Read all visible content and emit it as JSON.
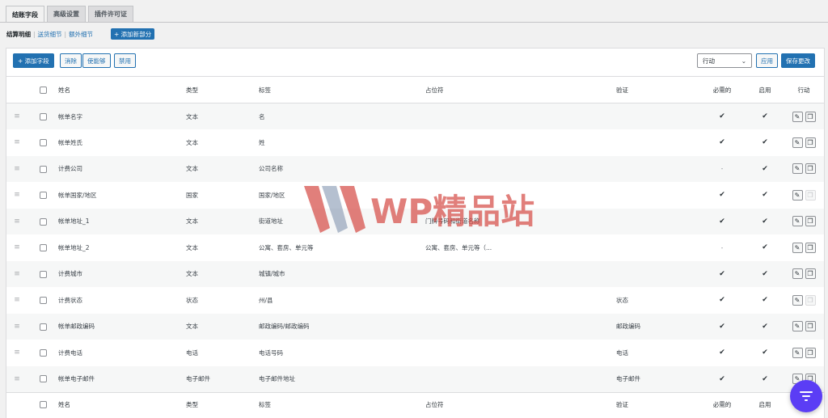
{
  "tabs": [
    {
      "label": "结账字段",
      "active": true
    },
    {
      "label": "高级设置",
      "active": false
    },
    {
      "label": "插件许可证",
      "active": false
    }
  ],
  "sections": {
    "current": "结算明细",
    "links": [
      "送货细节",
      "额外细节"
    ],
    "add_section_label": "+ 添加新部分"
  },
  "toolbar": {
    "add_field": "+ 添加字段",
    "remove": "消除",
    "enable": "使能够",
    "disable": "禁用",
    "action_select": "行动",
    "apply": "应用",
    "save": "保存更改"
  },
  "columns": {
    "name": "姓名",
    "type": "类型",
    "label": "标签",
    "placeholder": "占位符",
    "validation": "验证",
    "required": "必需的",
    "enabled": "启用",
    "actions": "行动"
  },
  "rows": [
    {
      "name": "帐单名字",
      "type": "文本",
      "label": "名",
      "placeholder": "",
      "validation": "",
      "required": "✔",
      "enabled": "✔",
      "dup_enabled": true
    },
    {
      "name": "帐单姓氏",
      "type": "文本",
      "label": "姓",
      "placeholder": "",
      "validation": "",
      "required": "✔",
      "enabled": "✔",
      "dup_enabled": true
    },
    {
      "name": "计费公司",
      "type": "文本",
      "label": "公司名称",
      "placeholder": "",
      "validation": "",
      "required": "-",
      "enabled": "✔",
      "dup_enabled": true
    },
    {
      "name": "帐单国家/地区",
      "type": "国家",
      "label": "国家/地区",
      "placeholder": "",
      "validation": "",
      "required": "✔",
      "enabled": "✔",
      "dup_enabled": false
    },
    {
      "name": "帐单地址_1",
      "type": "文本",
      "label": "街道地址",
      "placeholder": "门牌号码和街道名称",
      "validation": "",
      "required": "✔",
      "enabled": "✔",
      "dup_enabled": true
    },
    {
      "name": "帐单地址_2",
      "type": "文本",
      "label": "公寓、套房、单元等",
      "placeholder": "公寓、套房、单元等（...",
      "validation": "",
      "required": "-",
      "enabled": "✔",
      "dup_enabled": true
    },
    {
      "name": "计费城市",
      "type": "文本",
      "label": "城镇/城市",
      "placeholder": "",
      "validation": "",
      "required": "✔",
      "enabled": "✔",
      "dup_enabled": true
    },
    {
      "name": "计费状态",
      "type": "状态",
      "label": "州/县",
      "placeholder": "",
      "validation": "状态",
      "required": "✔",
      "enabled": "✔",
      "dup_enabled": false
    },
    {
      "name": "帐单邮政编码",
      "type": "文本",
      "label": "邮政编码/邮政编码",
      "placeholder": "",
      "validation": "邮政编码",
      "required": "✔",
      "enabled": "✔",
      "dup_enabled": true
    },
    {
      "name": "计费电话",
      "type": "电话",
      "label": "电话号码",
      "placeholder": "",
      "validation": "电话",
      "required": "✔",
      "enabled": "✔",
      "dup_enabled": true
    },
    {
      "name": "帐单电子邮件",
      "type": "电子邮件",
      "label": "电子邮件地址",
      "placeholder": "",
      "validation": "电子邮件",
      "required": "✔",
      "enabled": "✔",
      "dup_enabled": true
    }
  ],
  "watermark": {
    "text": "WP精品站"
  },
  "icons": {
    "drag": "drag-handle-icon",
    "edit": "pencil-icon",
    "duplicate": "copy-icon",
    "chat": "chat-widget-icon"
  },
  "colors": {
    "primary": "#2271b1",
    "watermark": "#d64e48",
    "chat": "#5b3df5"
  }
}
